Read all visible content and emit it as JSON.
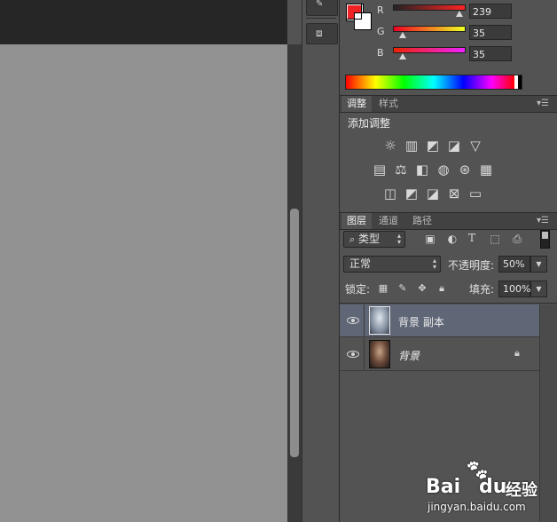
{
  "color_panel": {
    "channels": [
      {
        "name": "R",
        "value": "239",
        "fraction": 0.937,
        "gradient": [
          "#232323",
          "#ff2323"
        ]
      },
      {
        "name": "G",
        "value": "35",
        "fraction": 0.137,
        "gradient": [
          "#ef0023",
          "#efff23"
        ]
      },
      {
        "name": "B",
        "value": "35",
        "fraction": 0.137,
        "gradient": [
          "#ef2300",
          "#ef23ff"
        ]
      }
    ],
    "foreground_color": "#ef2323",
    "background_color": "#ffffff"
  },
  "adjustments_panel": {
    "tabs": [
      {
        "label": "调整",
        "active": true
      },
      {
        "label": "样式",
        "active": false
      }
    ],
    "title": "添加调整",
    "icons_row1": [
      "brightness-contrast-icon",
      "levels-icon",
      "curves-icon",
      "exposure-icon",
      "vibrance-icon"
    ],
    "icons_row2": [
      "hue-saturation-icon",
      "color-balance-icon",
      "black-white-icon",
      "photo-filter-icon",
      "channel-mixer-icon",
      "color-lookup-icon"
    ],
    "icons_row3": [
      "invert-icon",
      "posterize-icon",
      "threshold-icon",
      "selective-color-icon",
      "gradient-map-icon"
    ]
  },
  "layers_panel": {
    "tabs": [
      {
        "label": "图层",
        "active": true
      },
      {
        "label": "通道",
        "active": false
      },
      {
        "label": "路径",
        "active": false
      }
    ],
    "filter_kind": "类型",
    "blend_mode": "正常",
    "opacity_label": "不透明度:",
    "opacity_value": "50%",
    "lock_label": "锁定:",
    "fill_label": "填充:",
    "fill_value": "100%",
    "type_icon_text": "T",
    "layers": [
      {
        "name": "背景 副本",
        "selected": true,
        "locked": false,
        "italic": false
      },
      {
        "name": "背景",
        "selected": false,
        "locked": true,
        "italic": true
      }
    ]
  },
  "watermark": {
    "brand": "Bai",
    "brand2": "du",
    "brand3": "经验",
    "url": "jingyan.baidu.com"
  }
}
